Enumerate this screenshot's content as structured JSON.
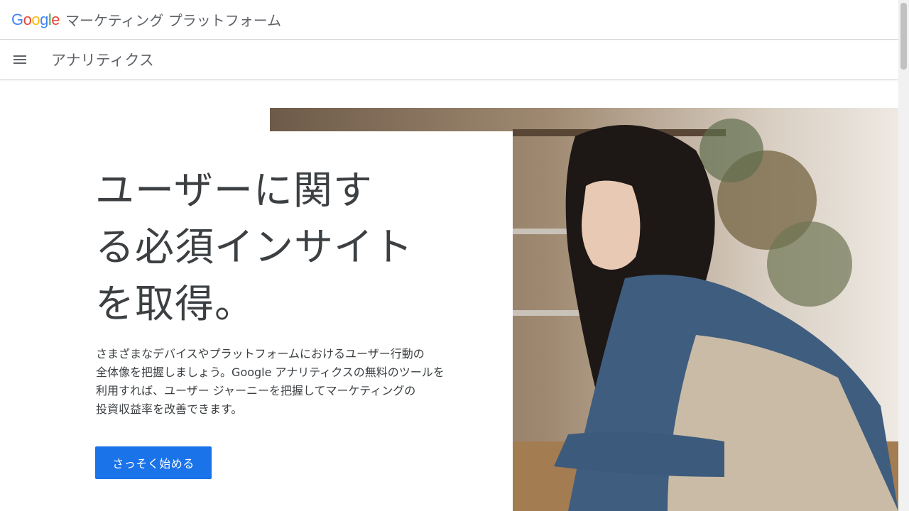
{
  "brand": {
    "logo_letters": [
      {
        "char": "G",
        "color": "#4285F4"
      },
      {
        "char": "o",
        "color": "#EA4335"
      },
      {
        "char": "o",
        "color": "#FBBC05"
      },
      {
        "char": "g",
        "color": "#4285F4"
      },
      {
        "char": "l",
        "color": "#34A853"
      },
      {
        "char": "e",
        "color": "#EA4335"
      }
    ],
    "platform_name": "マーケティング プラットフォーム"
  },
  "nav": {
    "menu_icon": "hamburger-menu-icon",
    "product_name": "アナリティクス"
  },
  "hero": {
    "headline": "ユーザーに関する必須インサイトを取得。",
    "description": "さまざまなデバイスやプラットフォームにおけるユーザー行動の\n全体像を把握しましょう。Google アナリティクスの無料のツールを\n利用すれば、ユーザー ジャーニーを把握してマーケティングの\n投資収益率を改善できます。",
    "cta_label": "さっそく始める",
    "cta_color": "#1a73e8"
  }
}
